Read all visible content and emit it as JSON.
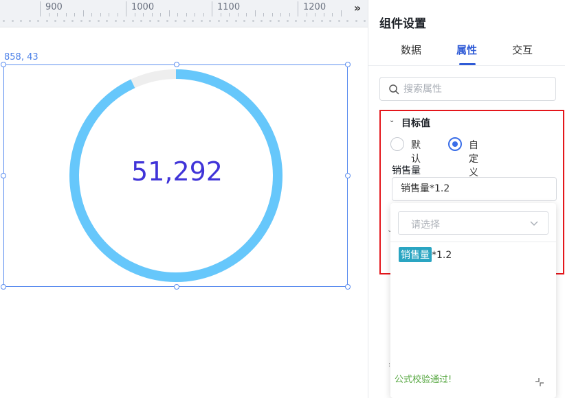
{
  "ruler": {
    "labels": [
      "900",
      "1000",
      "1100",
      "1200"
    ]
  },
  "canvas": {
    "coordinate": "858, 43",
    "gauge": {
      "value_text": "51,292",
      "progress_fraction": 0.93,
      "track_color": "#eeeeee",
      "fill_color": "#66c7fb",
      "value_color": "#4034d8"
    }
  },
  "panel": {
    "title": "组件设置",
    "tabs": [
      {
        "label": "数据",
        "active": false
      },
      {
        "label": "属性",
        "active": true
      },
      {
        "label": "交互",
        "active": false
      }
    ],
    "search": {
      "placeholder": "搜索属性",
      "value": ""
    },
    "section": {
      "title": "目标值",
      "radios": [
        {
          "label": "默认",
          "checked": false
        },
        {
          "label": "自定义",
          "checked": true
        }
      ],
      "field_label": "销售量",
      "formula_value": "销售量*1.2"
    },
    "dropdown": {
      "select_placeholder": "请选择",
      "formula_field": "销售量",
      "formula_rest": "*1.2",
      "validation_message": "公式校验通过!"
    }
  },
  "colors": {
    "accent": "#2f5bd6",
    "highlight_border": "#e4161b",
    "success": "#58a843",
    "tag": "#2aa5c2"
  }
}
